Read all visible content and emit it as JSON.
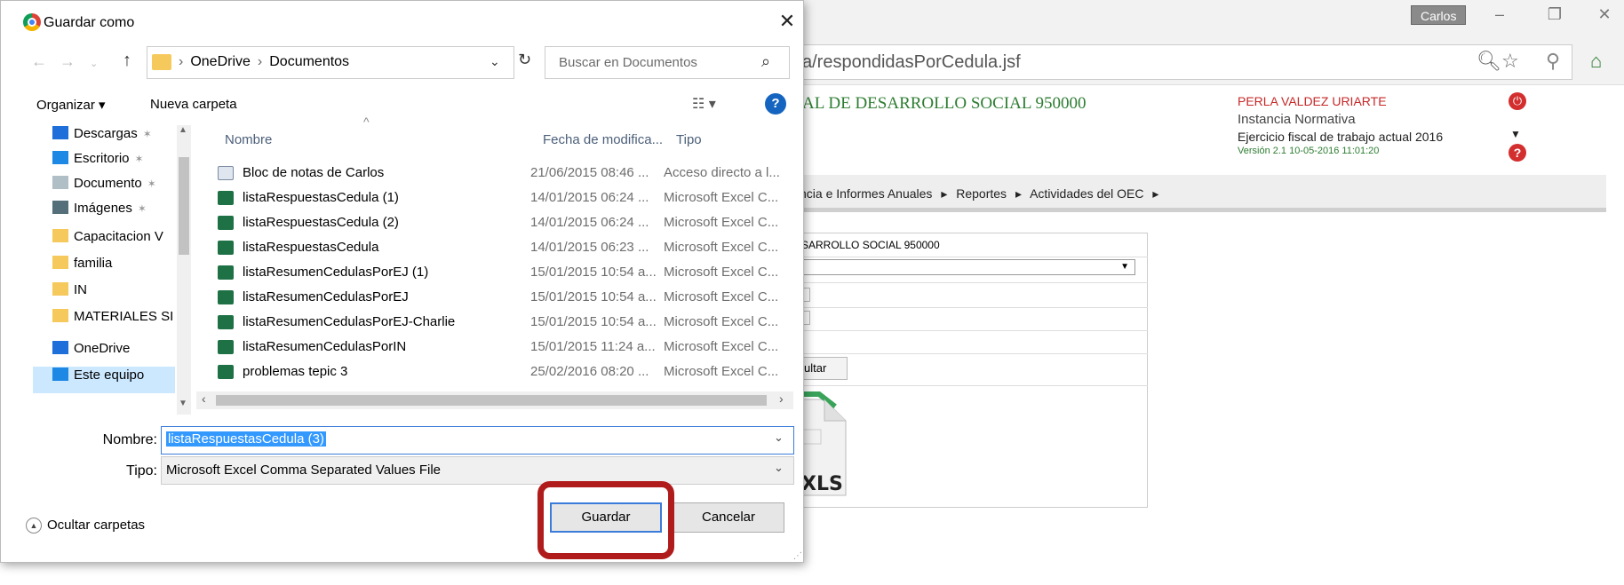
{
  "browser": {
    "user_badge": "Carlos",
    "window_min": "–",
    "window_restore": "❐",
    "window_close": "✕",
    "address": "a/respondidasPorCedula.jsf",
    "site_title": "AL DE DESARROLLO SOCIAL 950000",
    "user_name": "PERLA VALDEZ URIARTE",
    "instancia": "Instancia Normativa",
    "ejercicio": "Ejercicio fiscal de trabajo actual  2016",
    "version": "Versión 2.1    10-05-2016 11:01:20",
    "menu": [
      "ncia e Informes Anuales",
      "▸",
      "Reportes",
      "▸",
      "Actividades del OEC",
      "▸"
    ],
    "panel_title": "SARROLLO SOCIAL 950000",
    "consultar": "ultar",
    "xls_label": "XLS"
  },
  "dialog": {
    "title": "Guardar como",
    "breadcrumb": [
      "OneDrive",
      "Documentos"
    ],
    "search_placeholder": "Buscar en Documentos",
    "organizar": "Organizar ▾",
    "nueva_carpeta": "Nueva carpeta",
    "nav_items": [
      {
        "label": "Descargas",
        "pinned": true,
        "color": "#1e6fd9"
      },
      {
        "label": "Escritorio",
        "pinned": true,
        "color": "#1e88e5"
      },
      {
        "label": "Documento",
        "pinned": true,
        "color": "#b0bec5"
      },
      {
        "label": "Imágenes",
        "pinned": true,
        "color": "#546e7a"
      },
      {
        "label": "Capacitacion V",
        "pinned": false,
        "color": "#f6c95c"
      },
      {
        "label": "familia",
        "pinned": false,
        "color": "#f6c95c"
      },
      {
        "label": "IN",
        "pinned": false,
        "color": "#f6c95c"
      },
      {
        "label": "MATERIALES SI",
        "pinned": false,
        "color": "#f6c95c"
      },
      {
        "label": "OneDrive",
        "pinned": false,
        "color": "#1e6fd9"
      },
      {
        "label": "Este equipo",
        "pinned": false,
        "color": "#1e88e5"
      }
    ],
    "columns": {
      "name": "Nombre",
      "date": "Fecha de modifica...",
      "type": "Tipo"
    },
    "files": [
      {
        "name": "Bloc de notas de Carlos",
        "date": "21/06/2015 08:46 ...",
        "type": "Acceso directo a l...",
        "kind": "link"
      },
      {
        "name": "listaRespuestasCedula (1)",
        "date": "14/01/2015 06:24 ...",
        "type": "Microsoft Excel C...",
        "kind": "xls"
      },
      {
        "name": "listaRespuestasCedula (2)",
        "date": "14/01/2015 06:24 ...",
        "type": "Microsoft Excel C...",
        "kind": "xls"
      },
      {
        "name": "listaRespuestasCedula",
        "date": "14/01/2015 06:23 ...",
        "type": "Microsoft Excel C...",
        "kind": "xls"
      },
      {
        "name": "listaResumenCedulasPorEJ (1)",
        "date": "15/01/2015 10:54 a...",
        "type": "Microsoft Excel C...",
        "kind": "xls"
      },
      {
        "name": "listaResumenCedulasPorEJ",
        "date": "15/01/2015 10:54 a...",
        "type": "Microsoft Excel C...",
        "kind": "xls"
      },
      {
        "name": "listaResumenCedulasPorEJ-Charlie",
        "date": "15/01/2015 10:54 a...",
        "type": "Microsoft Excel C...",
        "kind": "xls"
      },
      {
        "name": "listaResumenCedulasPorIN",
        "date": "15/01/2015 11:24 a...",
        "type": "Microsoft Excel C...",
        "kind": "xls"
      },
      {
        "name": "problemas tepic 3",
        "date": "25/02/2016 08:20 ...",
        "type": "Microsoft Excel C...",
        "kind": "xls"
      }
    ],
    "nombre_label": "Nombre:",
    "nombre_value": "listaRespuestasCedula (3)",
    "tipo_label": "Tipo:",
    "tipo_value": "Microsoft Excel Comma Separated Values File",
    "ocultar": "Ocultar carpetas",
    "guardar": "Guardar",
    "cancelar": "Cancelar",
    "highlight_color": "#b01c1c"
  }
}
